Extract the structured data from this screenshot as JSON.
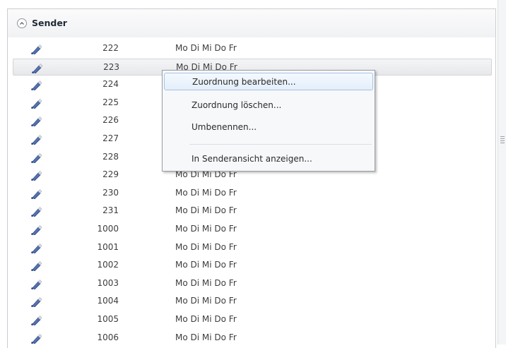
{
  "group": {
    "title": "Sender",
    "collapse_icon": "chevron-up-icon"
  },
  "rows": [
    {
      "id": "222",
      "days": "Mo Di Mi Do Fr"
    },
    {
      "id": "223",
      "days": "Mo Di Mi Do Fr",
      "selected": true
    },
    {
      "id": "224",
      "days": ""
    },
    {
      "id": "225",
      "days": ""
    },
    {
      "id": "226",
      "days": ""
    },
    {
      "id": "227",
      "days": ""
    },
    {
      "id": "228",
      "days": ""
    },
    {
      "id": "229",
      "days": "Mo Di Mi Do Fr"
    },
    {
      "id": "230",
      "days": "Mo Di Mi Do Fr"
    },
    {
      "id": "231",
      "days": "Mo Di Mi Do Fr"
    },
    {
      "id": "1000",
      "days": "Mo Di Mi Do Fr"
    },
    {
      "id": "1001",
      "days": "Mo Di Mi Do Fr"
    },
    {
      "id": "1002",
      "days": "Mo Di Mi Do Fr"
    },
    {
      "id": "1003",
      "days": "Mo Di Mi Do Fr"
    },
    {
      "id": "1004",
      "days": "Mo Di Mi Do Fr"
    },
    {
      "id": "1005",
      "days": "Mo Di Mi Do Fr"
    },
    {
      "id": "1006",
      "days": "Mo Di Mi Do Fr"
    }
  ],
  "row_icon": "transmitter-stick-icon",
  "context_menu": {
    "items": [
      {
        "label": "Zuordnung bearbeiten...",
        "hover": true
      },
      {
        "label": "Zuordnung löschen..."
      },
      {
        "label": "Umbenennen..."
      },
      {
        "label": "In Senderansicht anzeigen..."
      }
    ]
  },
  "colors": {
    "icon_blue": "#3b5fa8",
    "menu_hover_border": "#a6c3e6",
    "selection_border": "#d2d4d7"
  }
}
